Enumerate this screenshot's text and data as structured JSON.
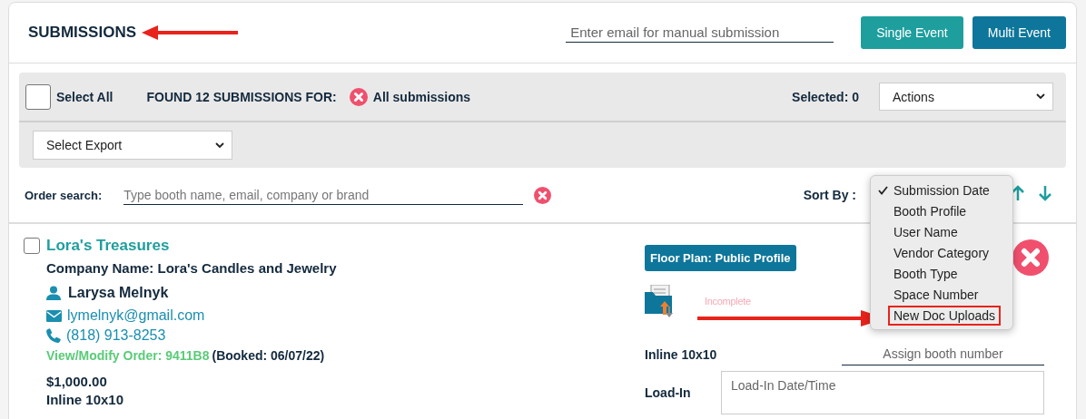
{
  "header": {
    "title": "SUBMISSIONS",
    "email_field": {
      "placeholder": "Enter email for manual submission"
    },
    "buttons": [
      {
        "label": "Single Event",
        "color": "#1f9e9e"
      },
      {
        "label": "Multi Event",
        "color": "#0e769a"
      }
    ]
  },
  "toolbar": {
    "select_all": {
      "label": "Select All",
      "checked": false
    },
    "found_label": "FOUND 12 SUBMISSIONS FOR:",
    "filter": "All submissions",
    "selected_count": "Selected: 0",
    "actions": "Actions",
    "export": "Select Export"
  },
  "search": {
    "label": "Order search:",
    "placeholder": "Type booth name, email, company or brand"
  },
  "sort": {
    "label": "Sort By :",
    "options": [
      {
        "label": "Submission Date",
        "selected": true,
        "highlighted": false
      },
      {
        "label": "Booth Profile",
        "selected": false,
        "highlighted": false
      },
      {
        "label": "User Name",
        "selected": false,
        "highlighted": false
      },
      {
        "label": "Vendor Category",
        "selected": false,
        "highlighted": false
      },
      {
        "label": "Booth Type",
        "selected": false,
        "highlighted": false
      },
      {
        "label": "Space Number",
        "selected": false,
        "highlighted": false
      },
      {
        "label": "New Doc Uploads",
        "selected": false,
        "highlighted": true
      }
    ]
  },
  "submissions": [
    {
      "checked": false,
      "name": "Lora's Treasures",
      "company": "Company Name: Lora's Candles and Jewelry",
      "contact": "Larysa Melnyk",
      "email": "lymelnyk@gmail.com",
      "phone": "(818) 913-8253",
      "order_link": "View/Modify Order: 9411B8",
      "booked": "(Booked: 06/07/22)",
      "price": "$1,000.00",
      "booth_type": "Inline 10x10",
      "floor_plan_button": "Floor Plan: Public Profile",
      "doc_status": "Incomplete",
      "booth_type_right": "Inline 10x10",
      "booth_number": {
        "placeholder": "Assign booth number"
      },
      "load_in": {
        "label": "Load-In",
        "placeholder": "Load-In Date/Time"
      }
    }
  ]
}
